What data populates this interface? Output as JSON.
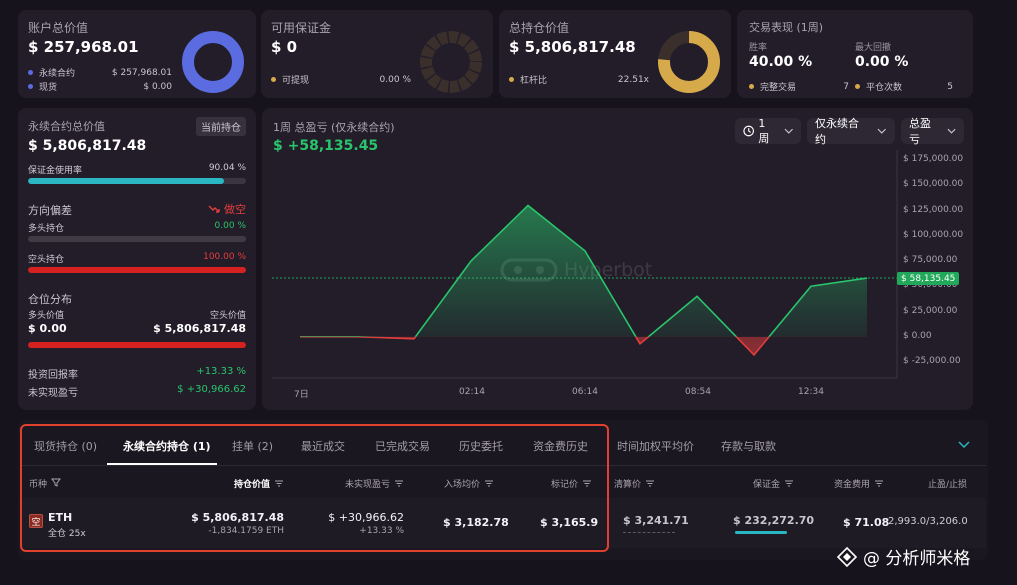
{
  "account": {
    "title": "账户总价值",
    "value": "$ 257,968.01",
    "rows": [
      {
        "label": "永续合约",
        "value": "$ 257,968.01"
      },
      {
        "label": "现货",
        "value": "$ 0.00"
      }
    ]
  },
  "margin": {
    "title": "可用保证金",
    "value": "$ 0",
    "row_label": "可提现",
    "row_value": "0.00 %"
  },
  "holding": {
    "title": "总持仓价值",
    "value": "$ 5,806,817.48",
    "row_label": "杠杆比",
    "row_value": "22.51x"
  },
  "performance": {
    "title": "交易表现 (1周)",
    "win_label": "胜率",
    "win_value": "40.00 %",
    "drawdown_label": "最大回撤",
    "drawdown_value": "0.00 %",
    "done_label": "完整交易",
    "done_value": "7",
    "close_label": "平仓次数",
    "close_value": "5"
  },
  "perp": {
    "title": "永续合约总价值",
    "badge": "当前持仓",
    "value": "$ 5,806,817.48",
    "margin_usage_label": "保证金使用率",
    "margin_usage_value": "90.04 %",
    "margin_usage_pct": 0.9004,
    "direction_label": "方向偏差",
    "direction_value": "做空",
    "long_label": "多头持仓",
    "long_value": "0.00 %",
    "short_label": "空头持仓",
    "short_value": "100.00 %",
    "dist_label": "仓位分布",
    "long_val_label": "多头价值",
    "short_val_label": "空头价值",
    "long_val": "$ 0.00",
    "short_val": "$ 5,806,817.48",
    "roi_label": "投资回报率",
    "roi_value": "+13.33 %",
    "upnl_label": "未实现盈亏",
    "upnl_value": "$ +30,966.62"
  },
  "chart_header": {
    "title": "1周 总盈亏 (仅永续合约)",
    "value": "$ +58,135.45",
    "period": "1周",
    "scope": "仅永续合约",
    "metric": "总盈亏",
    "watermark": "Hyperbot",
    "price_tag": "$ 58,135.45"
  },
  "chart_data": {
    "type": "area",
    "title": "1周 总盈亏 (仅永续合约)",
    "x_ticks": [
      "7日",
      "02:14",
      "06:14",
      "08:54",
      "12:34"
    ],
    "y_ticks": [
      "$ 175,000.00",
      "$ 150,000.00",
      "$ 125,000.00",
      "$ 100,000.00",
      "$ 75,000.00",
      "$ 50,000.00",
      "$ 25,000.00",
      "$ 0.00",
      "$ -25,000.00"
    ],
    "ylim": [
      -25000,
      175000
    ],
    "x_index": [
      0,
      1,
      2,
      3,
      4,
      5,
      6,
      7,
      8,
      9,
      10,
      11
    ],
    "values": [
      0,
      0,
      -2000,
      75000,
      130000,
      85000,
      -7000,
      40000,
      -18000,
      50000,
      58135.45
    ],
    "grid": false,
    "colors": {
      "up": "#29c46b",
      "down": "#e23d3d"
    }
  },
  "tabs": [
    {
      "label": "现货持仓 (0)"
    },
    {
      "label": "永续合约持仓 (1)"
    },
    {
      "label": "挂单 (2)"
    },
    {
      "label": "最近成交"
    },
    {
      "label": "已完成交易"
    },
    {
      "label": "历史委托"
    },
    {
      "label": "资金费历史"
    },
    {
      "label": "时间加权平均价"
    },
    {
      "label": "存款与取款"
    }
  ],
  "table": {
    "headers": [
      "币种",
      "持仓价值",
      "未实现盈亏",
      "入场均价",
      "标记价",
      "清算价",
      "保证金",
      "资金费用",
      "止盈/止损"
    ],
    "row": {
      "coin": "ETH",
      "coin_icon": "空",
      "mode": "全仓 25x",
      "value": "$ 5,806,817.48",
      "size": "-1,834.1759 ETH",
      "upnl": "$ +30,966.62",
      "upnl_pct": "+13.33 %",
      "entry": "$ 3,182.78",
      "mark": "$ 3,165.9",
      "liq": "$ 3,241.71",
      "margin": "$ 232,272.70",
      "funding": "$ 71.08",
      "tpsl": "2,993.0/3,206.0"
    }
  },
  "watermark_footer": "@ 分析师米格",
  "colors": {
    "accent_blue": "#5a6ce0",
    "accent_gold": "#d6a94a",
    "green": "#29c46b",
    "red": "#e23d3d",
    "teal": "#2ab7c3",
    "highlight_border": "#e0412e"
  }
}
